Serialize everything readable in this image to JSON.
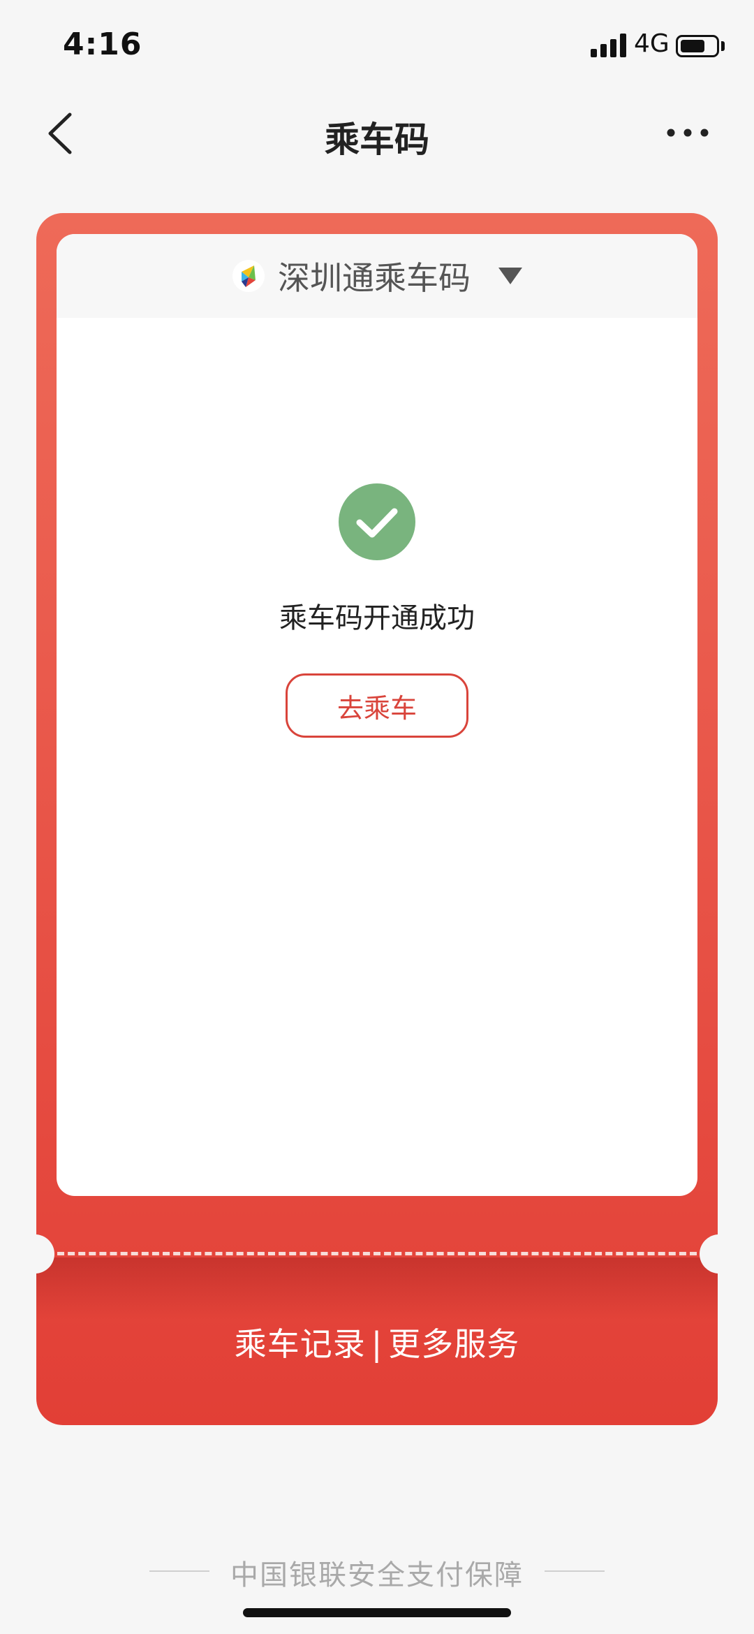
{
  "status_bar": {
    "time": "4:16",
    "network": "4G",
    "battery_level": 0.7
  },
  "header": {
    "title": "乘车码"
  },
  "card": {
    "selector_title": "深圳通乘车码",
    "success_message": "乘车码开通成功",
    "ride_button_label": "去乘车",
    "footer_link_records": "乘车记录",
    "footer_separator": "|",
    "footer_link_services": "更多服务"
  },
  "footer": {
    "security_text": "中国银联安全支付保障"
  },
  "colors": {
    "accent": "#e2453b",
    "success": "#79b47e",
    "button_text": "#d9443b"
  }
}
